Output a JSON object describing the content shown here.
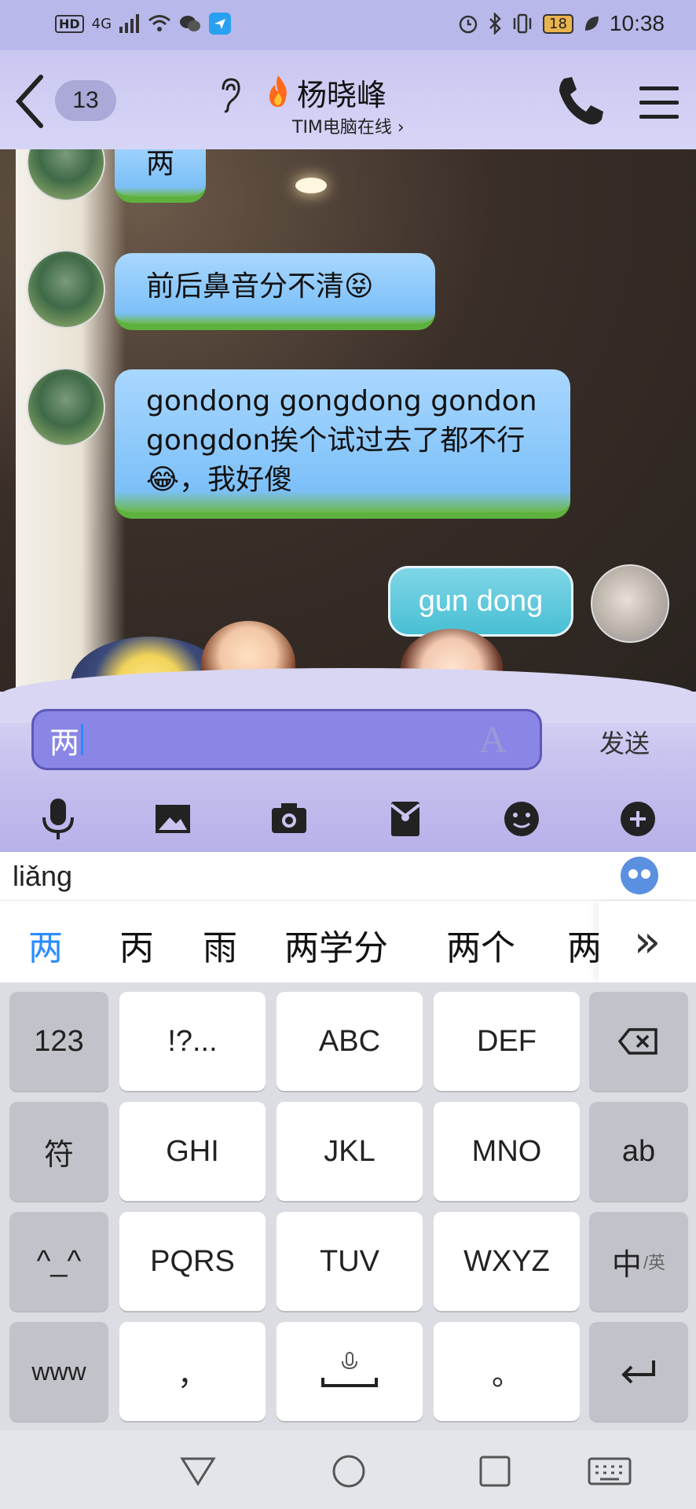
{
  "status_bar": {
    "hd": "HD",
    "net": "4G",
    "battery": "18",
    "time": "10:38"
  },
  "header": {
    "unread_count": "13",
    "contact_name": "杨晓峰",
    "contact_status": "TIM电脑在线",
    "status_chevron": "›"
  },
  "messages": [
    {
      "side": "left",
      "text": "两"
    },
    {
      "side": "left",
      "text": "前后鼻音分不清😝"
    },
    {
      "side": "left",
      "text": "gondong gongdong gondon gongdon挨个试过去了都不行😂，我好傻"
    },
    {
      "side": "right",
      "text": "gun dong"
    }
  ],
  "input": {
    "value": "两",
    "send_label": "发送",
    "font_icon": "A"
  },
  "toolbar_icons": [
    "microphone-icon",
    "image-icon",
    "camera-icon",
    "red-packet-icon",
    "emoji-icon",
    "plus-icon"
  ],
  "ime": {
    "pinyin": "liǎng",
    "candidates": [
      "两",
      "丙",
      "雨",
      "两学分",
      "两个",
      "两"
    ],
    "more_label": "»"
  },
  "keyboard": {
    "rows": [
      [
        "123",
        "!?...",
        "ABC",
        "DEF",
        "⌫"
      ],
      [
        "符",
        "GHI",
        "JKL",
        "MNO",
        "ab"
      ],
      [
        "^_^",
        "PQRS",
        "TUV",
        "WXYZ",
        "中"
      ],
      [
        "www",
        "，",
        "space",
        "。",
        "↵"
      ]
    ],
    "lang_sub": "/英"
  },
  "colors": {
    "accent": "#2b8cff",
    "header_bg": "#c9c7f0",
    "input_bg": "#8a86e6",
    "bubble_left": "#a9d7ff",
    "bubble_right": "#49bfd4"
  }
}
